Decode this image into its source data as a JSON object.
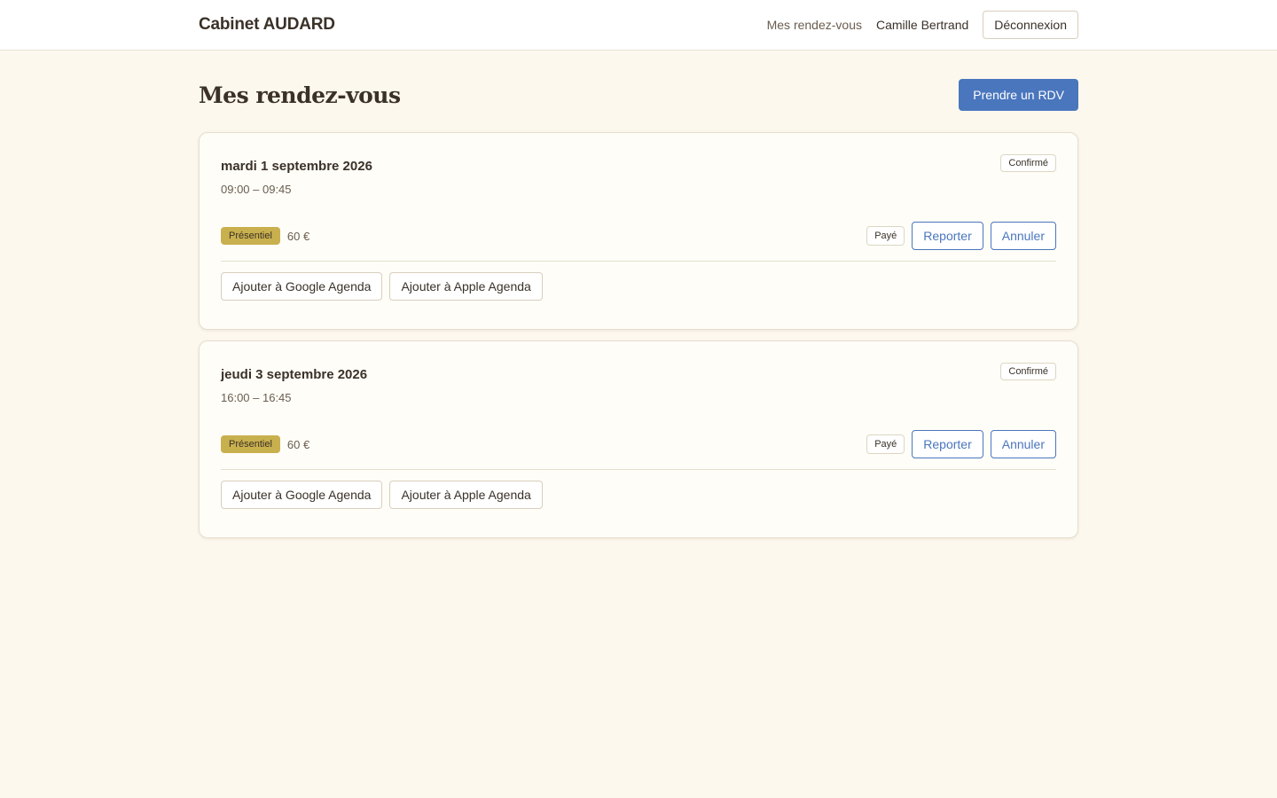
{
  "header": {
    "brand": "Cabinet AUDARD",
    "nav_link": "Mes rendez-vous",
    "user_name": "Camille Bertrand",
    "logout_label": "Déconnexion"
  },
  "page": {
    "title": "Mes rendez-vous",
    "new_appointment_label": "Prendre un RDV"
  },
  "appointments": [
    {
      "date": "mardi 1 septembre 2026",
      "time": "09:00 – 09:45",
      "status": "Confirmé",
      "mode": "Présentiel",
      "price": "60 €",
      "payment": "Payé",
      "reschedule_label": "Reporter",
      "cancel_label": "Annuler",
      "google_label": "Ajouter à Google Agenda",
      "apple_label": "Ajouter à Apple Agenda"
    },
    {
      "date": "jeudi 3 septembre 2026",
      "time": "16:00 – 16:45",
      "status": "Confirmé",
      "mode": "Présentiel",
      "price": "60 €",
      "payment": "Payé",
      "reschedule_label": "Reporter",
      "cancel_label": "Annuler",
      "google_label": "Ajouter à Google Agenda",
      "apple_label": "Ajouter à Apple Agenda"
    }
  ],
  "colors": {
    "background": "#fdf8ee",
    "accent": "#4a76bd",
    "mode_pill": "#c9b04e"
  }
}
